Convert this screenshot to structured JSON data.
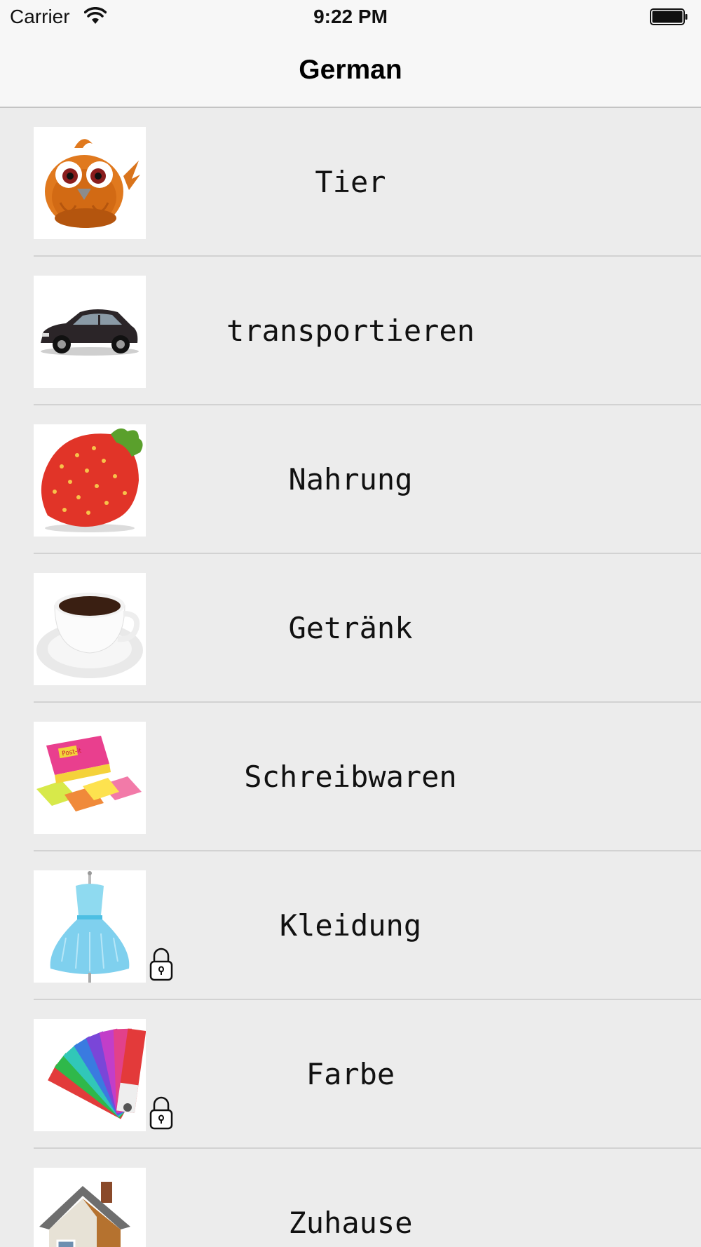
{
  "status_bar": {
    "carrier": "Carrier",
    "time": "9:22 PM",
    "wifi_icon": "wifi-icon",
    "battery_icon": "battery-icon"
  },
  "nav": {
    "title": "German"
  },
  "categories": [
    {
      "label": "Tier",
      "icon": "bird-icon",
      "locked": false
    },
    {
      "label": "transportieren",
      "icon": "car-icon",
      "locked": false
    },
    {
      "label": "Nahrung",
      "icon": "strawberry-icon",
      "locked": false
    },
    {
      "label": "Getränk",
      "icon": "coffee-cup-icon",
      "locked": false
    },
    {
      "label": "Schreibwaren",
      "icon": "sticky-notes-icon",
      "locked": false
    },
    {
      "label": "Kleidung",
      "icon": "dress-icon",
      "locked": true
    },
    {
      "label": "Farbe",
      "icon": "color-swatch-icon",
      "locked": true
    },
    {
      "label": "Zuhause",
      "icon": "house-icon",
      "locked": false
    }
  ],
  "colors": {
    "background": "#ececec",
    "nav_background": "#f7f7f7",
    "separator": "#d2d2d2"
  }
}
